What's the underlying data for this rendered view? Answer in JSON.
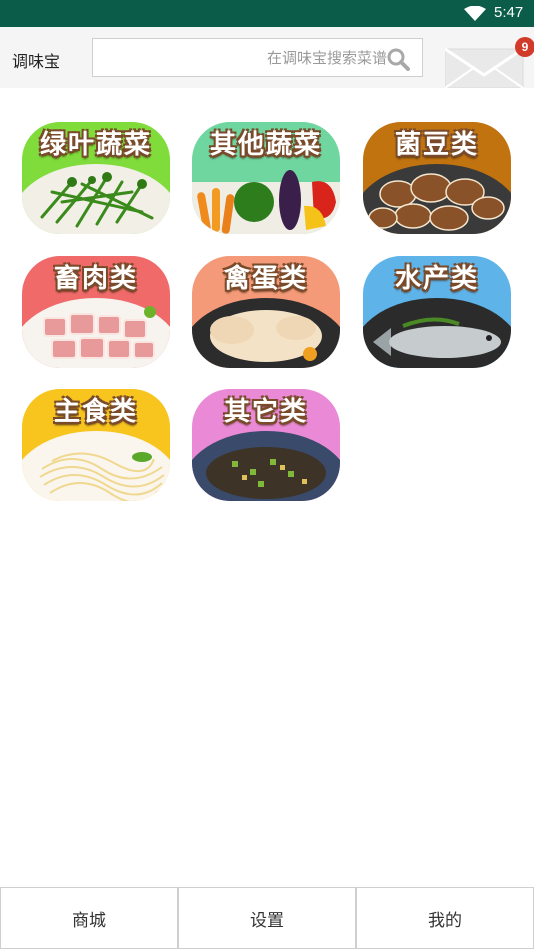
{
  "status_bar": {
    "time": "5:47"
  },
  "header": {
    "app_title": "调味宝",
    "search_placeholder": "在调味宝搜索菜谱",
    "message_count": "9"
  },
  "categories": [
    {
      "label": "绿叶蔬菜",
      "bg": "#7fdc3a",
      "food": "greens"
    },
    {
      "label": "其他蔬菜",
      "bg": "#6fd6a0",
      "food": "vegetables"
    },
    {
      "label": "菌豆类",
      "bg": "#c0730e",
      "food": "mushrooms"
    },
    {
      "label": "畜肉类",
      "bg": "#f06a6a",
      "food": "meat"
    },
    {
      "label": "禽蛋类",
      "bg": "#f49a78",
      "food": "poultry"
    },
    {
      "label": "水产类",
      "bg": "#5eb3e8",
      "food": "fish"
    },
    {
      "label": "主食类",
      "bg": "#f7c51e",
      "food": "noodles"
    },
    {
      "label": "其它类",
      "bg": "#ea8ad6",
      "food": "other"
    }
  ],
  "bottom_nav": {
    "shop": "商城",
    "settings": "设置",
    "mine": "我的"
  },
  "colors": {
    "status_bar": "#0b5d4a",
    "badge": "#d23a2a"
  }
}
